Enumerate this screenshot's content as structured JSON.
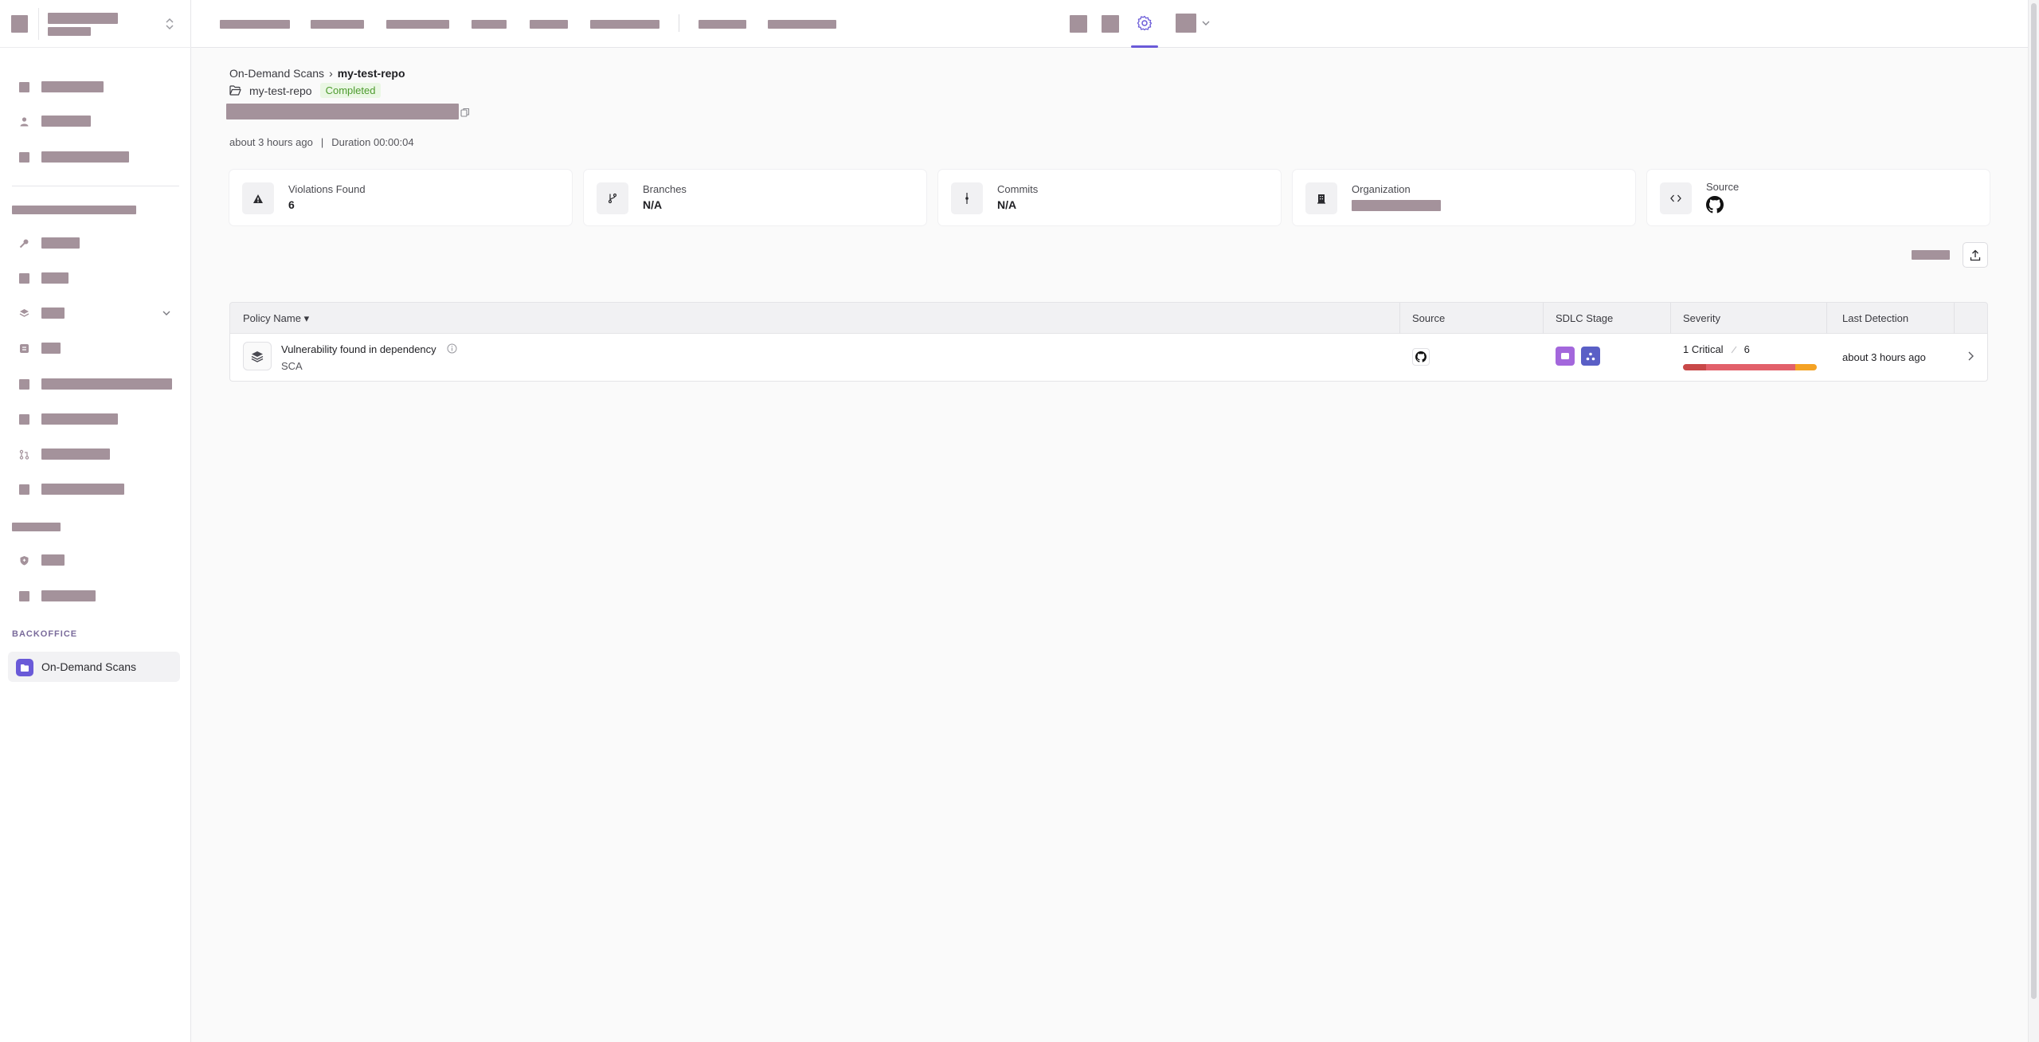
{
  "sidebar": {
    "backoffice_title": "BACKOFFICE",
    "active_item": {
      "label": "On-Demand Scans",
      "icon": "folder-icon"
    }
  },
  "breadcrumb": {
    "parent": "On-Demand Scans",
    "separator": "›",
    "current": "my-test-repo"
  },
  "repo": {
    "name": "my-test-repo",
    "status": "Completed",
    "status_color": "#4d9b2d"
  },
  "meta": {
    "time_ago": "about 3 hours ago",
    "separator": "|",
    "duration_label": "Duration",
    "duration": "00:00:04"
  },
  "stats": [
    {
      "label": "Violations Found",
      "value": "6",
      "icon": "warning-icon"
    },
    {
      "label": "Branches",
      "value": "N/A",
      "icon": "branch-icon"
    },
    {
      "label": "Commits",
      "value": "N/A",
      "icon": "commit-icon"
    },
    {
      "label": "Organization",
      "value": "",
      "icon": "building-icon"
    },
    {
      "label": "Source",
      "value": "",
      "icon": "code-icon"
    }
  ],
  "table": {
    "columns": [
      "Policy Name",
      "Source",
      "SDLC Stage",
      "Severity",
      "Last Detection"
    ],
    "sort_indicator": "▾",
    "rows": [
      {
        "policy_name": "Vulnerability found in dependency",
        "category": "SCA",
        "source_icon": "github-icon",
        "severity_label": "1 Critical",
        "total": "6",
        "severity_breakdown": [
          {
            "level": "critical",
            "fraction": 0.17,
            "color": "#c84848"
          },
          {
            "level": "high",
            "fraction": 0.67,
            "color": "#e2606a"
          },
          {
            "level": "medium",
            "fraction": 0.16,
            "color": "#f4a224"
          }
        ],
        "last_detection": "about 3 hours ago"
      }
    ]
  },
  "colors": {
    "accent": "#6a5ad8",
    "redacted": "#a4929b"
  }
}
